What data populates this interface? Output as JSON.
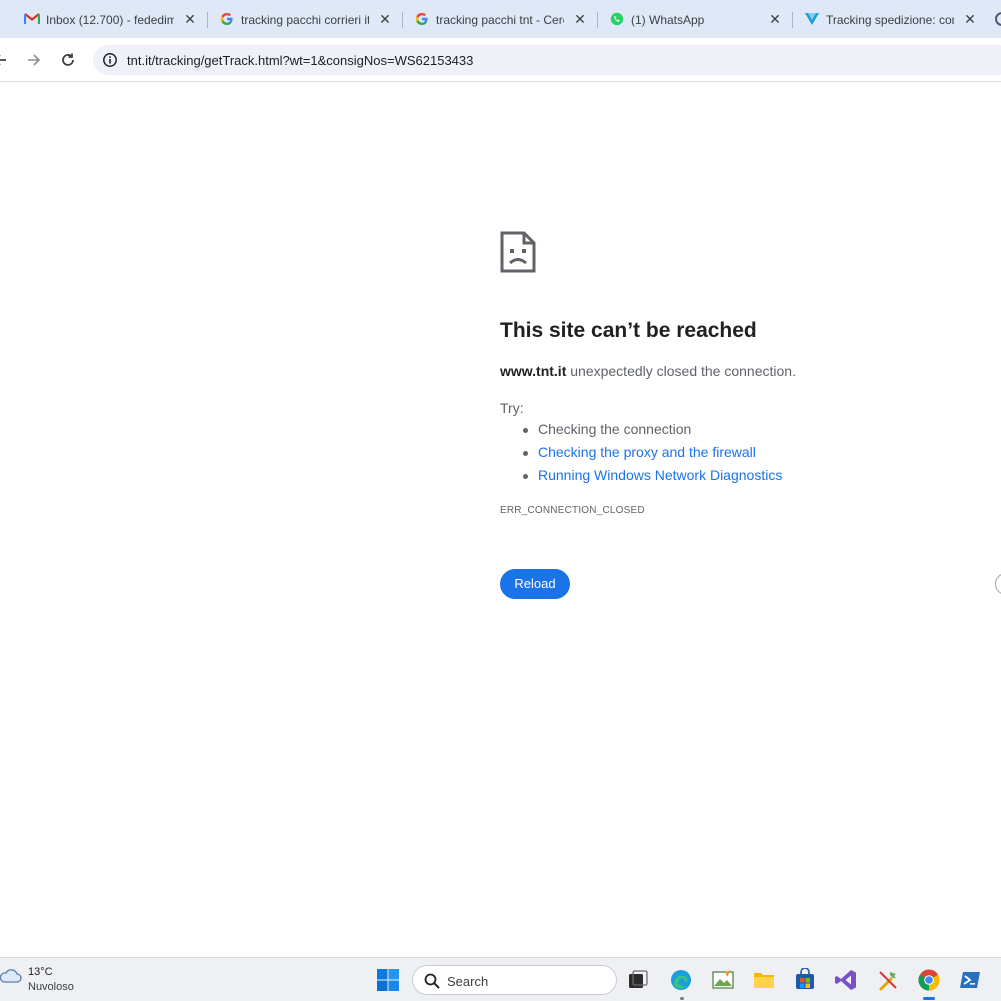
{
  "browser": {
    "tabs": [
      {
        "title": "Inbox (12.700) - fededim",
        "favicon": "gmail-icon",
        "close": "✕"
      },
      {
        "title": "tracking pacchi corrieri ita",
        "favicon": "google-icon",
        "close": "✕"
      },
      {
        "title": "tracking pacchi tnt - Cerca",
        "favicon": "google-icon",
        "close": "✕"
      },
      {
        "title": "(1) WhatsApp",
        "favicon": "whatsapp-icon",
        "close": "✕"
      },
      {
        "title": "Tracking spedizione: cont",
        "favicon": "tracking-site-icon",
        "close": "✕"
      }
    ],
    "url": "tnt.it/tracking/getTrack.html?wt=1&consigNos=WS62153433"
  },
  "error_page": {
    "title": "This site can’t be reached",
    "host": "www.tnt.it",
    "description": " unexpectedly closed the connection.",
    "try_label": "Try:",
    "suggestions": [
      {
        "text": "Checking the connection",
        "link": false
      },
      {
        "text": "Checking the proxy and the firewall",
        "link": true
      },
      {
        "text": "Running Windows Network Diagnostics",
        "link": true
      }
    ],
    "error_code": "ERR_CONNECTION_CLOSED",
    "reload_label": "Reload"
  },
  "taskbar": {
    "weather": {
      "temp": "13°C",
      "condition": "Nuvoloso"
    },
    "search_placeholder": "Search",
    "apps": [
      "windows-start-icon",
      "task-view-icon",
      "edge-icon",
      "image-editor-icon",
      "file-explorer-icon",
      "store-icon",
      "visual-studio-icon",
      "tools-icon",
      "chrome-icon",
      "powershell-icon"
    ]
  },
  "colors": {
    "accent": "#1a73e8",
    "tabstrip": "#dfe8f7",
    "text_primary": "#202124",
    "text_secondary": "#5f6368"
  }
}
